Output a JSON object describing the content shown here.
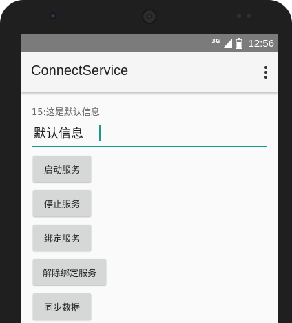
{
  "status_bar": {
    "network": "3G",
    "time": "12:56",
    "icons": [
      "signal-icon",
      "battery-icon"
    ]
  },
  "app_bar": {
    "title": "ConnectService",
    "menu_icon": "overflow-menu-icon"
  },
  "content": {
    "info_text": "15:这是默认信息",
    "input_value": "默认信息",
    "buttons": [
      {
        "label": "启动服务"
      },
      {
        "label": "停止服务"
      },
      {
        "label": "绑定服务"
      },
      {
        "label": "解除绑定服务"
      },
      {
        "label": "同步数据"
      }
    ]
  },
  "colors": {
    "accent": "#159a8c",
    "status_bar": "#7b7b7b",
    "app_bar": "#f5f5f5",
    "button": "#d6d7d7",
    "phone_frame": "#1f1f1f"
  }
}
